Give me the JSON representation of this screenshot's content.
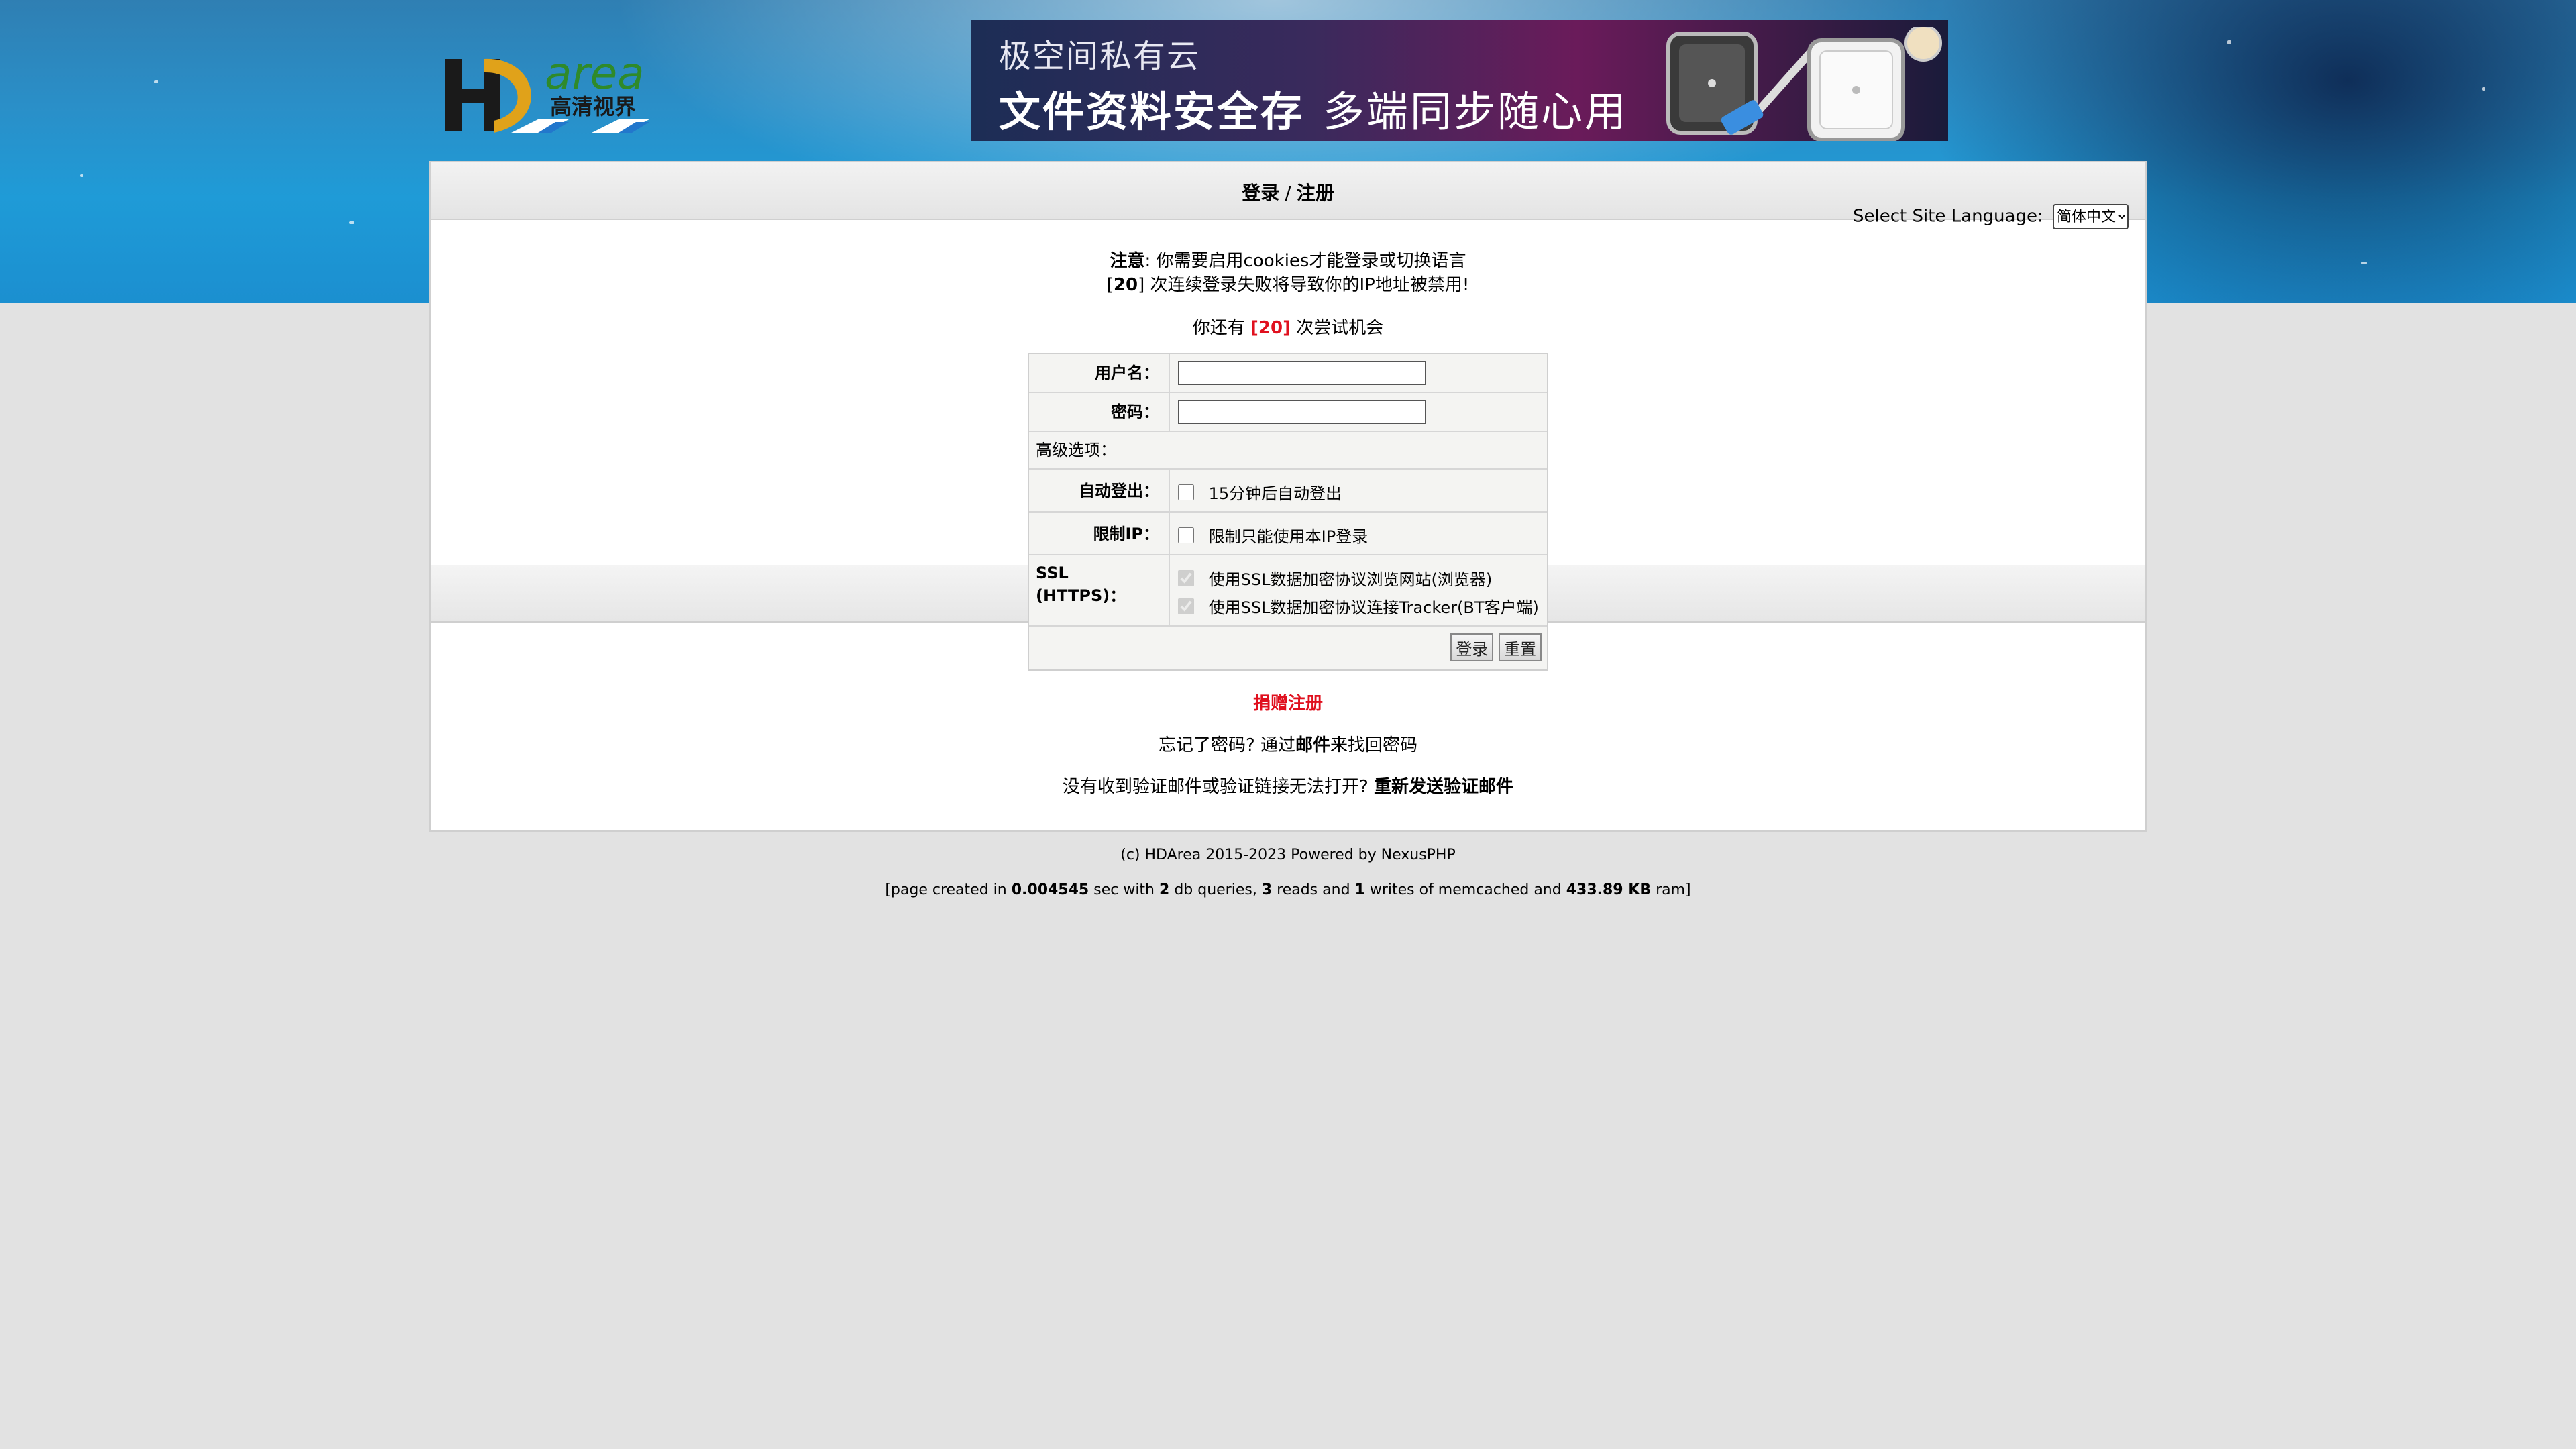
{
  "banner": {
    "line1": "极空间私有云",
    "line2_bold": "文件资料安全存",
    "line2_light": "多端同步随心用"
  },
  "logo": {
    "text": "area",
    "sub_text": "高清视界"
  },
  "nav": {
    "login": "登录",
    "separator": "/",
    "register": "注册"
  },
  "language": {
    "label": "Select Site Language:",
    "selected": "简体中文",
    "options": [
      "简体中文"
    ]
  },
  "notices": {
    "note_label": "注意",
    "note_text": ": 你需要启用cookies才能登录或切换语言",
    "fail_prefix": "[",
    "fail_count": "20",
    "fail_text": "] 次连续登录失败将导致你的IP地址被禁用!",
    "tries_prefix": "你还有",
    "tries_count": "[20]",
    "tries_suffix": "次尝试机会"
  },
  "form": {
    "username_label": "用户名：",
    "username_value": "",
    "password_label": "密码：",
    "password_value": "",
    "advanced_label": "高级选项：",
    "autologout_label": "自动登出：",
    "autologout_text": "15分钟后自动登出",
    "autologout_checked": false,
    "restrict_ip_label": "限制IP：",
    "restrict_ip_text": "限制只能使用本IP登录",
    "restrict_ip_checked": false,
    "ssl_label": "SSL (HTTPS)：",
    "ssl_browser_text": "使用SSL数据加密协议浏览网站(浏览器)",
    "ssl_tracker_text": "使用SSL数据加密协议连接Tracker(BT客户端)",
    "login_button": "登录",
    "reset_button": "重置"
  },
  "links": {
    "donate_register": "捐赠注册",
    "forgot_prefix": "忘记了密码? 通过",
    "forgot_link": "邮件",
    "forgot_suffix": "来找回密码",
    "resend_prefix": "没有收到验证邮件或验证链接无法打开?",
    "resend_link": "重新发送验证邮件"
  },
  "footer": {
    "copyright": "(c) HDArea 2015-2023 Powered by NexusPHP",
    "stats_prefix": "[page created in",
    "stats_time": "0.004545",
    "stats_mid1": "sec with",
    "stats_queries": "2",
    "stats_mid2": "db queries,",
    "stats_reads": "3",
    "stats_mid3": "reads and",
    "stats_writes": "1",
    "stats_mid4": "writes of memcached and",
    "stats_ram": "433.89 KB",
    "stats_suffix": "ram]"
  },
  "colors": {
    "accent_red": "#e0101e",
    "page_bg": "#e2e2e2",
    "header_blue": "#1f9bd7"
  }
}
